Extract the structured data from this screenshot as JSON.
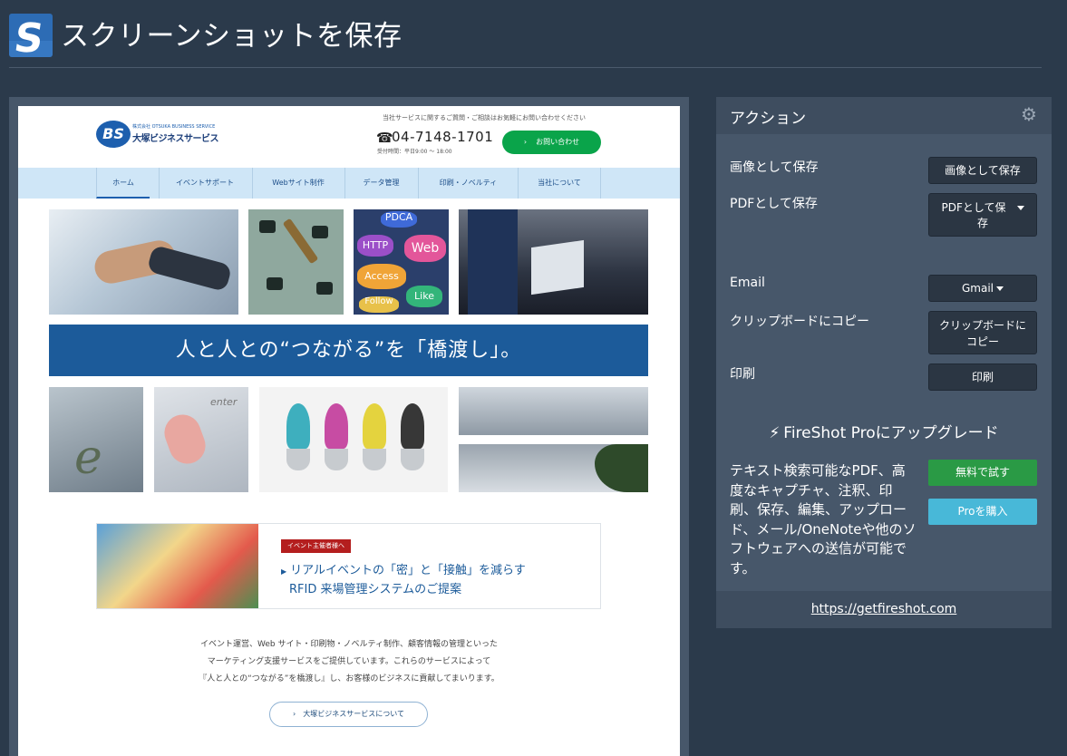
{
  "header": {
    "title": "スクリーンショットを保存",
    "logo_icon": "fireshot-logo-icon"
  },
  "preview": {
    "site_logo": {
      "mark": "BS",
      "subtitle": "株式会社 OTSUKA BUSINESS SERVICE",
      "name": "大塚ビジネスサービス"
    },
    "contact_note": "当社サービスに関するご質問・ご相談はお気軽にお問い合わせください",
    "phone": "04-7148-1701",
    "hours": "受付時間：平日9:00 ～ 18:00",
    "contact_button": "お問い合わせ",
    "nav": [
      "ホーム",
      "イベントサポート",
      "Webサイト制作",
      "データ管理",
      "印刷・ノベルティ",
      "当社について"
    ],
    "photo_words": [
      "PDCA",
      "HTTP",
      "Web",
      "Access",
      "Like",
      "Follow"
    ],
    "enter_word": "enter",
    "e_letter": "e",
    "banner": "人と人との“つながる”を「橋渡し」。",
    "event": {
      "badge": "イベント主催者様へ",
      "line1": "リアルイベントの「密」と「接触」を減らす",
      "line2": "RFID 来場管理システムのご提案"
    },
    "description": [
      "イベント運営、Web サイト・印刷物・ノベルティ制作、顧客情報の管理といった",
      "マーケティング支援サービスをご提供しています。これらのサービスによって",
      "『人と人との“つながる”を橋渡し』し、お客様のビジネスに貢献してまいります。"
    ],
    "about_button": "大塚ビジネスサービスについて"
  },
  "actions": {
    "title": "アクション",
    "settings_icon": "gear-icon",
    "rows": {
      "save_image_label": "画像として保存",
      "save_image_btn": "画像として保存",
      "save_pdf_label": "PDFとして保存",
      "save_pdf_btn_line1": "PDFとして保",
      "save_pdf_btn_line2": "存",
      "email_label": "Email",
      "email_btn": "Gmail",
      "clipboard_label": "クリップボードにコピー",
      "clipboard_btn_line1": "クリップボードに",
      "clipboard_btn_line2": "コピー",
      "print_label": "印刷",
      "print_btn": "印刷"
    },
    "upgrade_title": "FireShot Proにアップグレード",
    "upgrade_icon": "lightning-bolt-icon",
    "pro_description": "テキスト検索可能なPDF、高度なキャプチャ、注釈、印刷、保存、編集、アップロード、メール/OneNoteや他のソフトウェアへの送信が可能です。",
    "try_free_btn": "無料で試す",
    "buy_pro_btn": "Proを購入",
    "footer_link": "https://getfireshot.com"
  },
  "colors": {
    "background": "#2b3a4b",
    "panel": "#47576a",
    "green": "#2a9a45",
    "cyan": "#48b8d8"
  }
}
